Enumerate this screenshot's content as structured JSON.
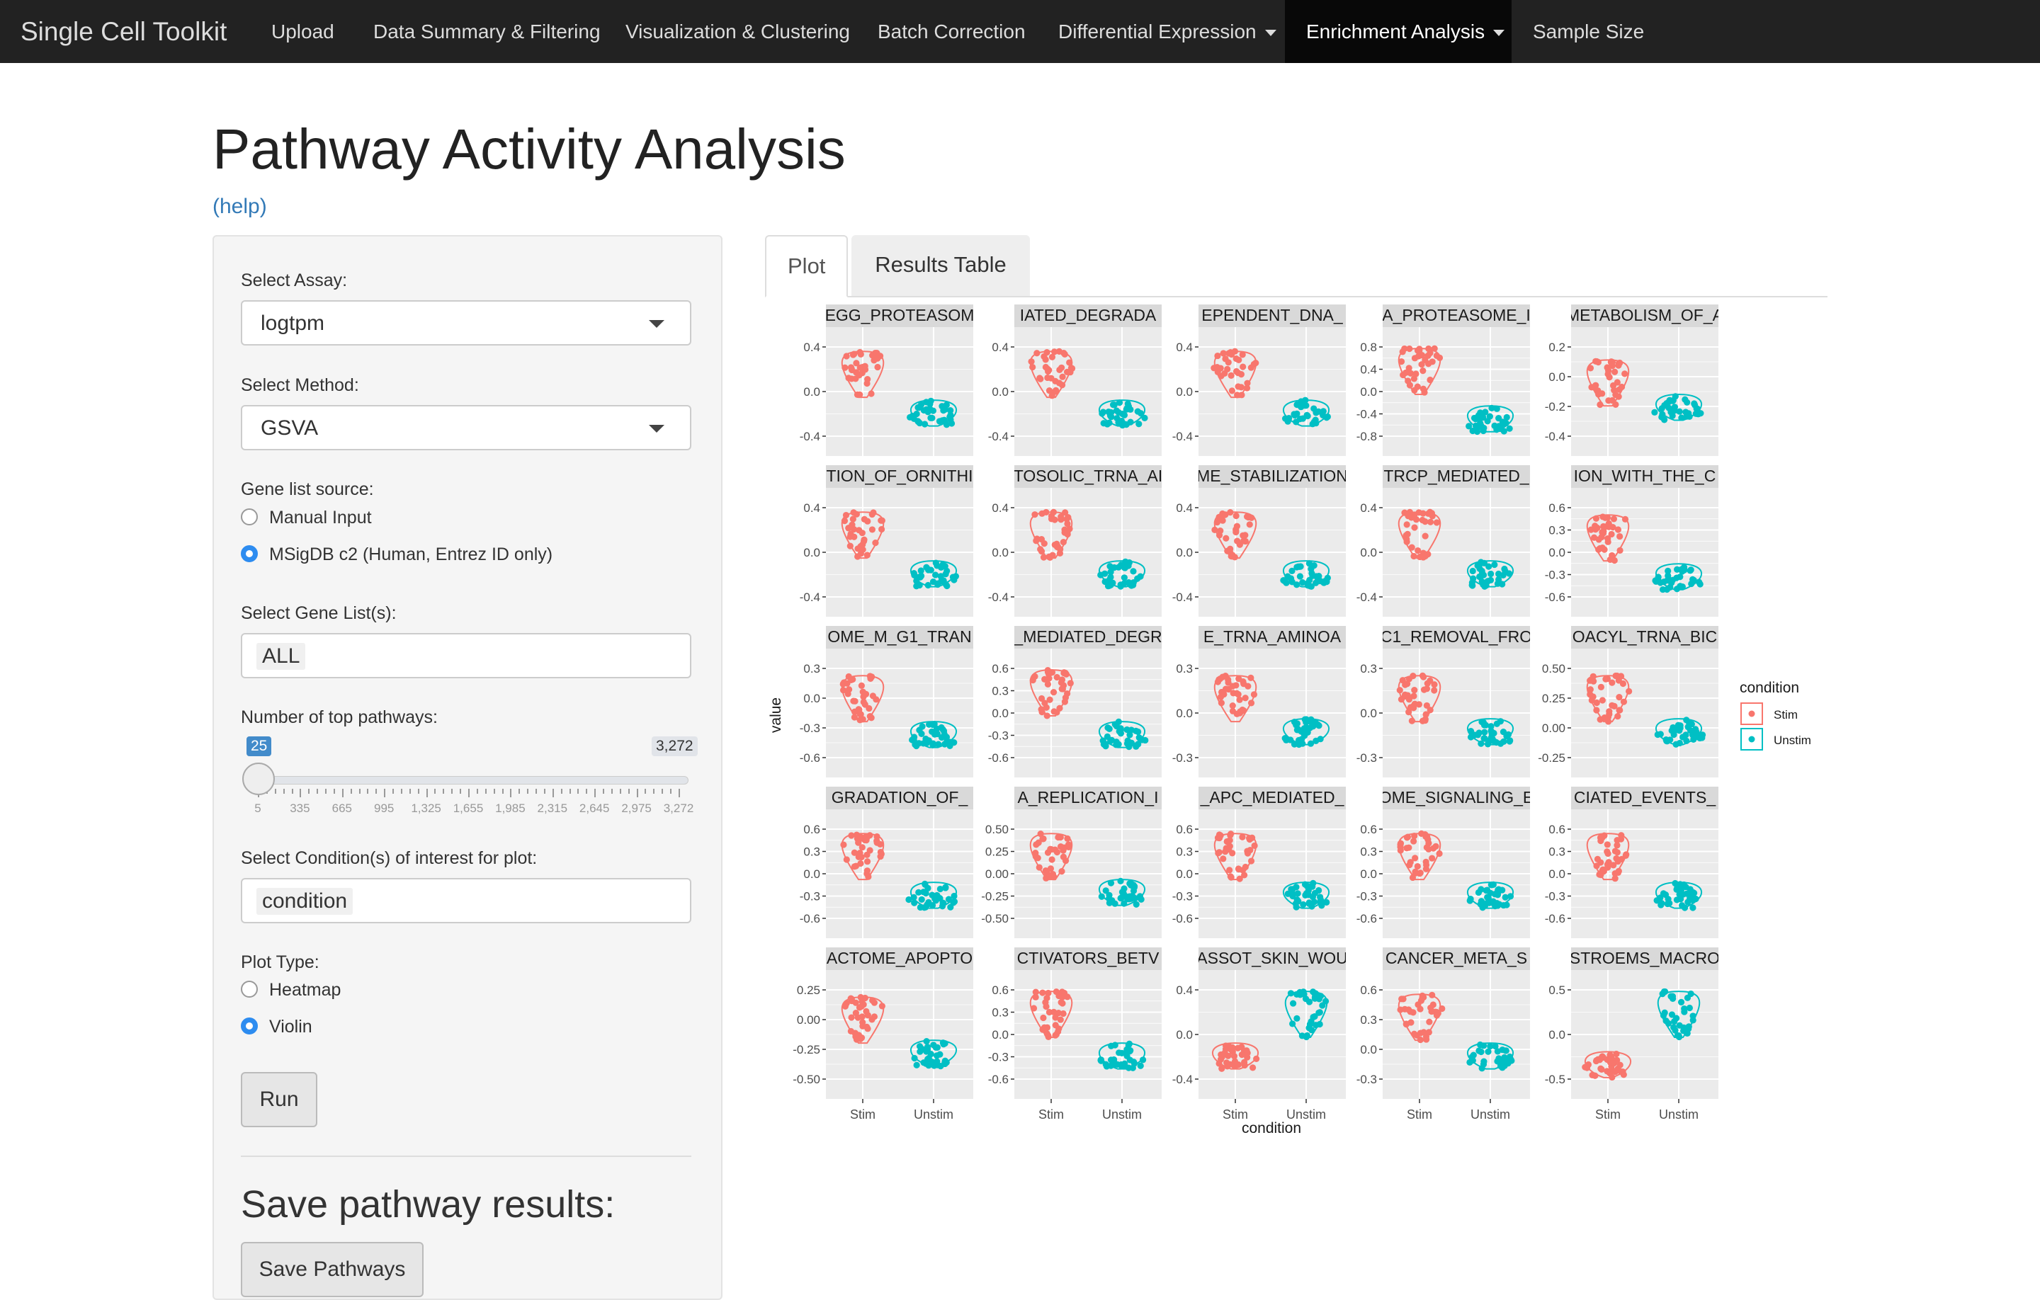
{
  "navbar": {
    "brand": "Single Cell Toolkit",
    "items": [
      {
        "label": "Upload"
      },
      {
        "label": "Data Summary & Filtering"
      },
      {
        "label": "Visualization & Clustering"
      },
      {
        "label": "Batch Correction"
      },
      {
        "label": "Differential Expression"
      },
      {
        "label": "Enrichment Analysis"
      },
      {
        "label": "Sample Size"
      }
    ]
  },
  "page": {
    "title": "Pathway Activity Analysis",
    "help": "(help)"
  },
  "sidebar": {
    "assay_label": "Select Assay:",
    "assay_value": "logtpm",
    "method_label": "Select Method:",
    "method_value": "GSVA",
    "genelist_source_label": "Gene list source:",
    "genelist_options": [
      {
        "label": "Manual Input",
        "selected": false
      },
      {
        "label": "MSigDB c2 (Human, Entrez ID only)",
        "selected": true
      }
    ],
    "genelist_label": "Select Gene List(s):",
    "genelist_value": "ALL",
    "top_label": "Number of top pathways:",
    "slider": {
      "value": "25",
      "max": "3,272",
      "ticks": [
        "5",
        "335",
        "665",
        "995",
        "1,325",
        "1,655",
        "1,985",
        "2,315",
        "2,645",
        "2,975",
        "3,272"
      ]
    },
    "condition_label": "Select Condition(s) of interest for plot:",
    "condition_value": "condition",
    "plot_type_label": "Plot Type:",
    "plot_type_options": [
      {
        "label": "Heatmap",
        "selected": false
      },
      {
        "label": "Violin",
        "selected": true
      }
    ],
    "run_label": "Run",
    "save_heading": "Save pathway results:",
    "save_label": "Save Pathways"
  },
  "tabs": [
    {
      "label": "Plot",
      "active": true
    },
    {
      "label": "Results Table",
      "active": false
    }
  ],
  "colors": {
    "stim": "#F8766D",
    "unstim": "#00BFC4",
    "panel": "#EBEBEB",
    "strip": "#D9D9D9"
  },
  "chart_data": {
    "type": "violin",
    "xlabel": "condition",
    "ylabel": "value",
    "categories": [
      "Stim",
      "Unstim"
    ],
    "legend": {
      "title": "condition",
      "entries": [
        "Stim",
        "Unstim"
      ],
      "placement": "right"
    },
    "panels": [
      {
        "strip": "EGG_PROTEASOM",
        "ticks": [
          "0.4",
          "0.0",
          "-0.4"
        ],
        "stim_center": 0.25,
        "unstim_center": -0.35
      },
      {
        "strip": "IATED_DEGRADA",
        "ticks": [
          "0.4",
          "0.0",
          "-0.4"
        ],
        "stim_center": 0.25,
        "unstim_center": -0.35
      },
      {
        "strip": "EPENDENT_DNA_",
        "ticks": [
          "0.4",
          "0.0",
          "-0.4"
        ],
        "stim_center": 0.25,
        "unstim_center": -0.35
      },
      {
        "strip": "A_PROTEASOME_I",
        "ticks": [
          "0.8",
          "0.4",
          "0.0",
          "-0.4",
          "-0.8"
        ],
        "stim_center": 0.3,
        "unstim_center": -0.45
      },
      {
        "strip": "METABOLISM_OF_A",
        "ticks": [
          "0.2",
          "0.0",
          "-0.2",
          "-0.4"
        ],
        "stim_center": 0.1,
        "unstim_center": -0.25
      },
      {
        "strip": "TION_OF_ORNITHI",
        "ticks": [
          "0.4",
          "0.0",
          "-0.4"
        ],
        "stim_center": 0.25,
        "unstim_center": -0.35
      },
      {
        "strip": "TOSOLIC_TRNA_AI",
        "ticks": [
          "0.4",
          "0.0",
          "-0.4"
        ],
        "stim_center": 0.25,
        "unstim_center": -0.35
      },
      {
        "strip": "ME_STABILIZATION",
        "ticks": [
          "0.4",
          "0.0",
          "-0.4"
        ],
        "stim_center": 0.25,
        "unstim_center": -0.35
      },
      {
        "strip": "TRCP_MEDIATED_",
        "ticks": [
          "0.4",
          "0.0",
          "-0.4"
        ],
        "stim_center": 0.25,
        "unstim_center": -0.35
      },
      {
        "strip": "ION_WITH_THE_C",
        "ticks": [
          "0.6",
          "0.3",
          "0.0",
          "-0.3",
          "-0.6"
        ],
        "stim_center": 0.2,
        "unstim_center": -0.4
      },
      {
        "strip": "OME_M_G1_TRAN",
        "ticks": [
          "0.3",
          "0.0",
          "-0.3",
          "-0.6"
        ],
        "stim_center": 0.2,
        "unstim_center": -0.35
      },
      {
        "strip": "_MEDIATED_DEGR",
        "ticks": [
          "0.6",
          "0.3",
          "0.0",
          "-0.3",
          "-0.6"
        ],
        "stim_center": 0.3,
        "unstim_center": -0.35
      },
      {
        "strip": "E_TRNA_AMINOA",
        "ticks": [
          "0.3",
          "0.0",
          "-0.3"
        ],
        "stim_center": 0.2,
        "unstim_center": -0.3
      },
      {
        "strip": "C1_REMOVAL_FRO",
        "ticks": [
          "0.3",
          "0.0",
          "-0.3"
        ],
        "stim_center": 0.2,
        "unstim_center": -0.3
      },
      {
        "strip": "OACYL_TRNA_BIC",
        "ticks": [
          "0.50",
          "0.25",
          "0.00",
          "-0.25"
        ],
        "stim_center": 0.2,
        "unstim_center": -0.3
      },
      {
        "strip": "GRADATION_OF_",
        "ticks": [
          "0.6",
          "0.3",
          "0.0",
          "-0.3",
          "-0.6"
        ],
        "stim_center": 0.25,
        "unstim_center": -0.35
      },
      {
        "strip": "A_REPLICATION_I",
        "ticks": [
          "0.50",
          "0.25",
          "0.00",
          "-0.25",
          "-0.50"
        ],
        "stim_center": 0.25,
        "unstim_center": -0.3
      },
      {
        "strip": "_APC_MEDIATED_",
        "ticks": [
          "0.6",
          "0.3",
          "0.0",
          "-0.3",
          "-0.6"
        ],
        "stim_center": 0.25,
        "unstim_center": -0.35
      },
      {
        "strip": "OME_SIGNALING_E",
        "ticks": [
          "0.6",
          "0.3",
          "0.0",
          "-0.3",
          "-0.6"
        ],
        "stim_center": 0.25,
        "unstim_center": -0.35
      },
      {
        "strip": "CIATED_EVENTS_",
        "ticks": [
          "0.6",
          "0.3",
          "0.0",
          "-0.3",
          "-0.6"
        ],
        "stim_center": 0.25,
        "unstim_center": -0.35
      },
      {
        "strip": "ACTOME_APOPTO",
        "ticks": [
          "0.25",
          "0.00",
          "-0.25",
          "-0.50"
        ],
        "stim_center": 0.2,
        "unstim_center": -0.3
      },
      {
        "strip": "CTIVATORS_BETV",
        "ticks": [
          "0.6",
          "0.3",
          "0.0",
          "-0.3",
          "-0.6"
        ],
        "stim_center": 0.3,
        "unstim_center": -0.35
      },
      {
        "strip": "ASSOT_SKIN_WOU",
        "ticks": [
          "0.4",
          "0.0",
          "-0.4"
        ],
        "stim_center": -0.35,
        "unstim_center": 0.3
      },
      {
        "strip": "CANCER_META_S",
        "ticks": [
          "0.6",
          "0.3",
          "0.0",
          "-0.3"
        ],
        "stim_center": 0.25,
        "unstim_center": -0.35
      },
      {
        "strip": "STROEMS_MACRO",
        "ticks": [
          "0.5",
          "0.0",
          "-0.5"
        ],
        "stim_center": -0.5,
        "unstim_center": 0.3
      }
    ]
  }
}
